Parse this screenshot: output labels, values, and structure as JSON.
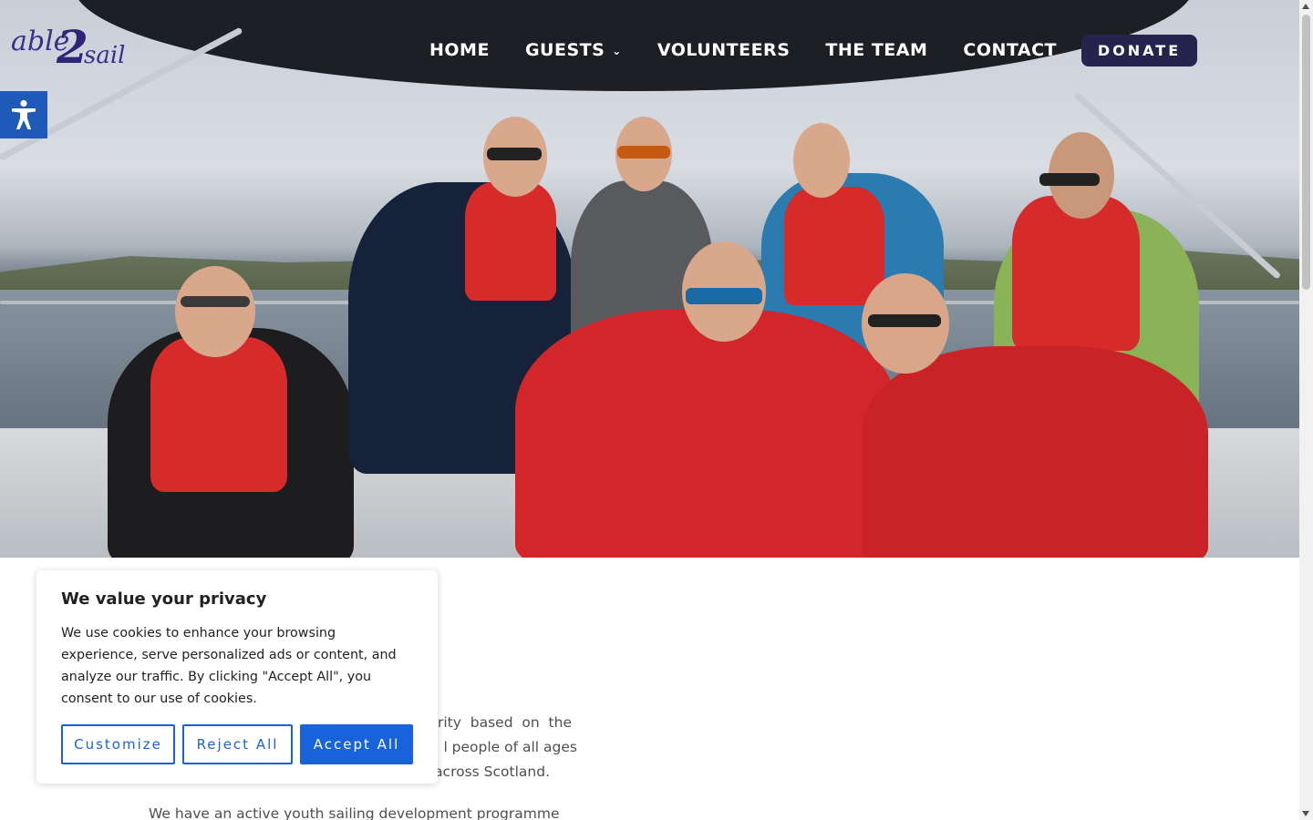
{
  "header": {
    "logo": {
      "part1": "able",
      "part2": "2",
      "part3": "sail"
    },
    "nav": [
      {
        "label": "HOME"
      },
      {
        "label": "GUESTS",
        "has_dropdown": true
      },
      {
        "label": "VOLUNTEERS"
      },
      {
        "label": "THE TEAM"
      },
      {
        "label": "CONTACT"
      }
    ],
    "donate_label": "DONATE"
  },
  "accessibility": {
    "icon": "accessibility-icon"
  },
  "hero": {
    "photo": "crew-on-sailboat-photo"
  },
  "content": {
    "paragraph1_visible": [
      "rity  based  on  the",
      "l people of all ages",
      "across Scotland."
    ],
    "paragraph2_visible": "We have an active youth sailing development programme"
  },
  "cookie_banner": {
    "title": "We value your privacy",
    "text": "We use cookies to enhance your browsing experience, serve personalized ads or content, and analyze our traffic. By clicking \"Accept All\", you consent to our use of cookies.",
    "buttons": {
      "customize": "Customize",
      "reject": "Reject All",
      "accept": "Accept All"
    }
  },
  "colors": {
    "brand_navy": "#27234f",
    "logo_purple": "#3a2f8c",
    "accessibility_blue": "#1f5ab8",
    "cookie_blue": "#1863dc"
  }
}
